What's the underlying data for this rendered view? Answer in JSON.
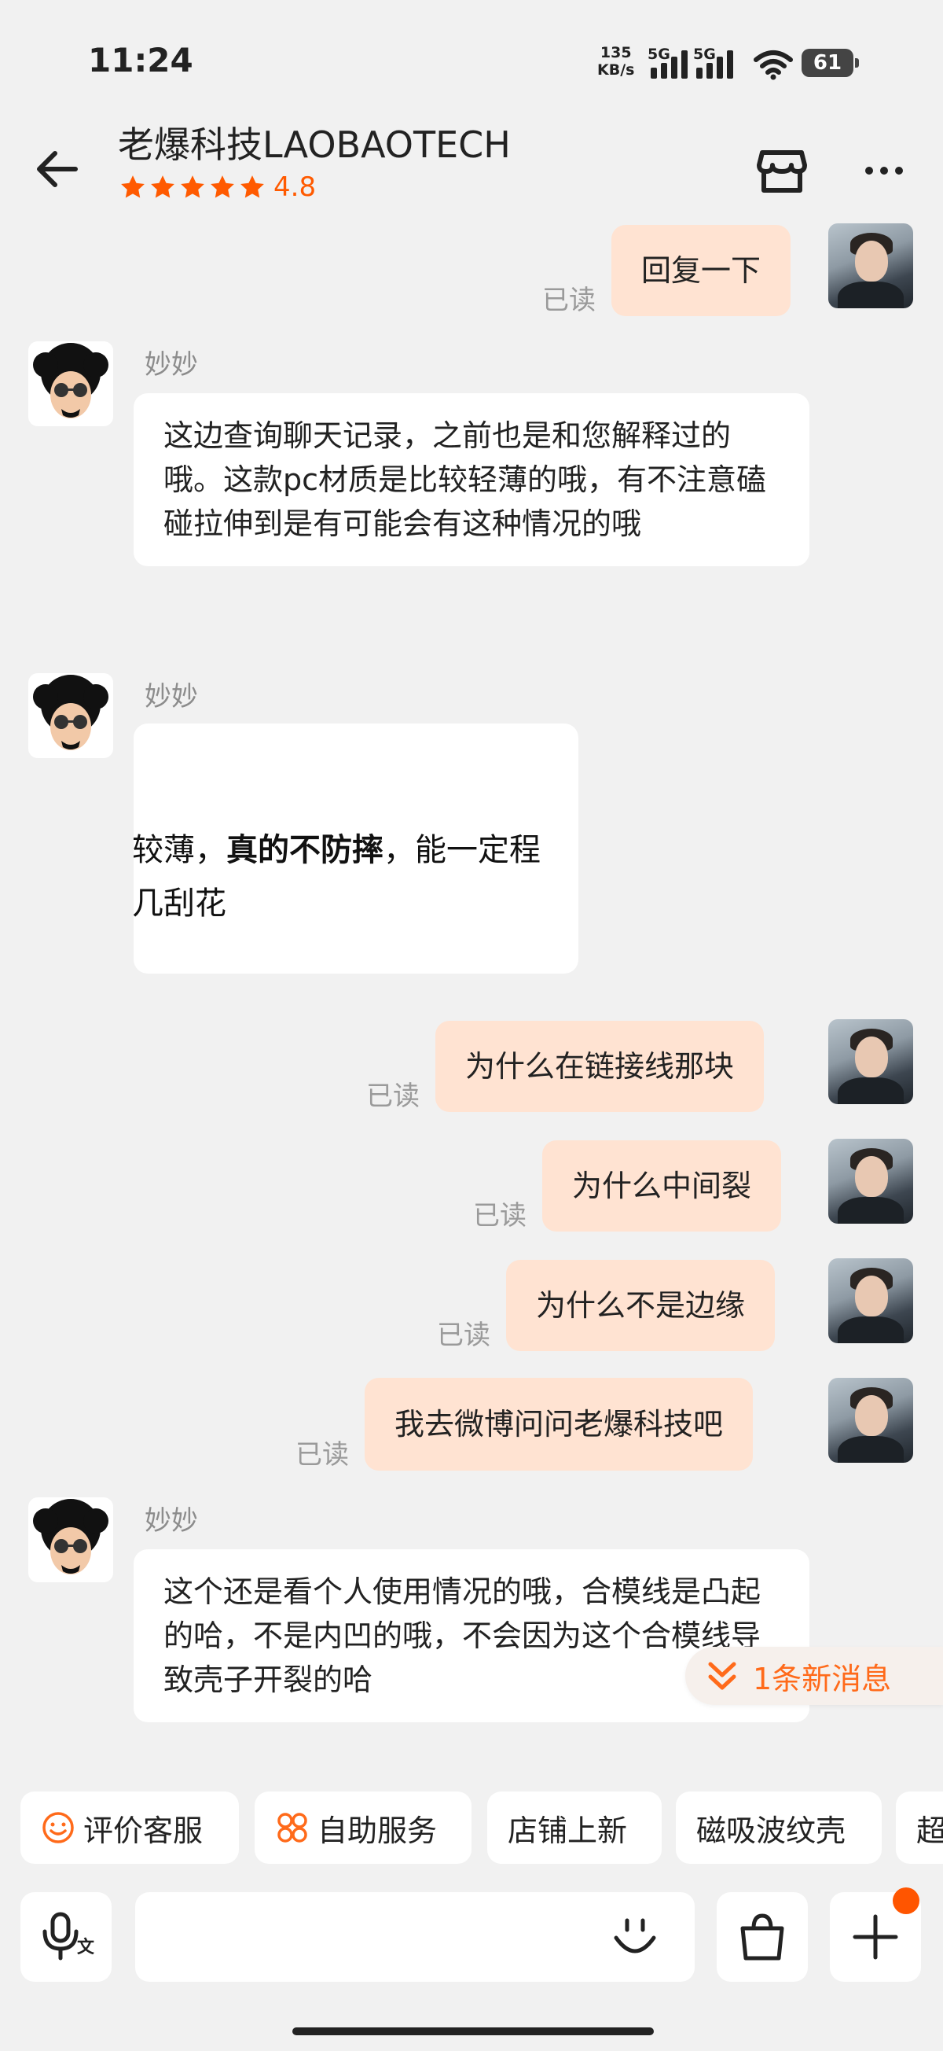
{
  "status_bar": {
    "time": "11:24",
    "net_speed_value": "135",
    "net_speed_unit": "KB/s",
    "sim1_label": "5G",
    "sim2_label": "5G",
    "battery": "61"
  },
  "header": {
    "title": "老爆科技LAOBAOTECH",
    "rating": "4.8",
    "star_color": "#ff5a00",
    "icons": [
      "back-arrow-icon",
      "store-icon",
      "more-icon"
    ]
  },
  "messages": {
    "m1": {
      "text": "回复一下",
      "read": "已读"
    },
    "m2": {
      "sender": "妙妙",
      "text": "这边查询聊天记录，之前也是和您解释过的哦。这款pc材质是比较轻薄的哦，有不注意磕碰拉伸到是有可能会有这种情况的哦"
    },
    "m3": {
      "sender": "妙妙",
      "image_line1_a": "较薄，",
      "image_line1_b": "真的不防摔",
      "image_line1_c": "，能一定程",
      "image_line2": "几刮花"
    },
    "m4": {
      "text": "为什么在链接线那块",
      "read": "已读"
    },
    "m5": {
      "text": "为什么中间裂",
      "read": "已读"
    },
    "m6": {
      "text": "为什么不是边缘",
      "read": "已读"
    },
    "m7": {
      "text": "我去微博问问老爆科技吧",
      "read": "已读"
    },
    "m8": {
      "sender": "妙妙",
      "text": "这个还是看个人使用情况的哦，合模线是凸起的哈，不是内凹的哦，不会因为这个合模线导致壳子开裂的哈"
    }
  },
  "new_messages": {
    "label": "1条新消息"
  },
  "quick_chips": [
    {
      "label": "评价客服"
    },
    {
      "label": "自助服务"
    },
    {
      "label": "店铺上新"
    },
    {
      "label": "磁吸波纹壳"
    },
    {
      "label": "超"
    }
  ],
  "input_bar": {
    "voice_sub_label": "文",
    "accent_color": "#ff5500"
  }
}
